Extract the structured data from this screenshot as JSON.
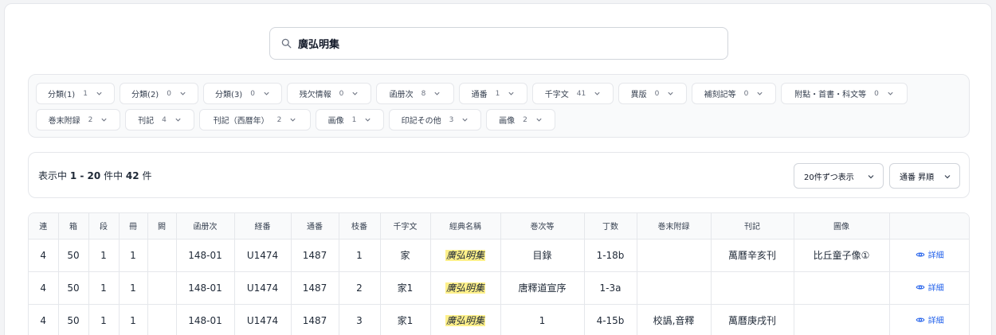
{
  "search": {
    "value": "廣弘明集"
  },
  "filters": [
    {
      "label": "分類(1)",
      "count": "1"
    },
    {
      "label": "分類(2)",
      "count": "0"
    },
    {
      "label": "分類(3)",
      "count": "0"
    },
    {
      "label": "残欠情報",
      "count": "0"
    },
    {
      "label": "函册次",
      "count": "8"
    },
    {
      "label": "通番",
      "count": "1"
    },
    {
      "label": "千字文",
      "count": "41"
    },
    {
      "label": "異版",
      "count": "0"
    },
    {
      "label": "補刻記等",
      "count": "0"
    },
    {
      "label": "附點・首書・科文等",
      "count": "0"
    },
    {
      "label": "巻末附録",
      "count": "2"
    },
    {
      "label": "刊記",
      "count": "4"
    },
    {
      "label": "刊記（西暦年）",
      "count": "2"
    },
    {
      "label": "画像",
      "count": "1"
    },
    {
      "label": "印記その他",
      "count": "3"
    },
    {
      "label": "画像",
      "count": "2"
    }
  ],
  "results": {
    "prefix": "表示中",
    "range_start": "1",
    "range_sep": " - ",
    "range_end": "20",
    "mid": "件中",
    "total": "42",
    "suffix": "件",
    "per_page": "20件ずつ表示",
    "sort": "通番 昇順"
  },
  "table": {
    "headers": [
      "連",
      "箱",
      "段",
      "冊",
      "闕",
      "函册次",
      "経番",
      "通番",
      "枝番",
      "千字文",
      "經典名稱",
      "巻次等",
      "丁数",
      "巻末附録",
      "刊記",
      "圖像",
      ""
    ],
    "rows": [
      [
        "4",
        "50",
        "1",
        "1",
        "",
        "148-01",
        "U1474",
        "1487",
        "1",
        "家",
        "廣弘明集",
        "目錄",
        "1-18b",
        "",
        "萬曆辛亥刊",
        "比丘童子像①"
      ],
      [
        "4",
        "50",
        "1",
        "1",
        "",
        "148-01",
        "U1474",
        "1487",
        "2",
        "家1",
        "廣弘明集",
        "唐釋道宣序",
        "1-3a",
        "",
        "",
        ""
      ],
      [
        "4",
        "50",
        "1",
        "1",
        "",
        "148-01",
        "U1474",
        "1487",
        "3",
        "家1",
        "廣弘明集",
        "1",
        "4-15b",
        "校譌,音釋",
        "萬曆庚戌刊",
        ""
      ]
    ],
    "detail_label": "詳細"
  }
}
